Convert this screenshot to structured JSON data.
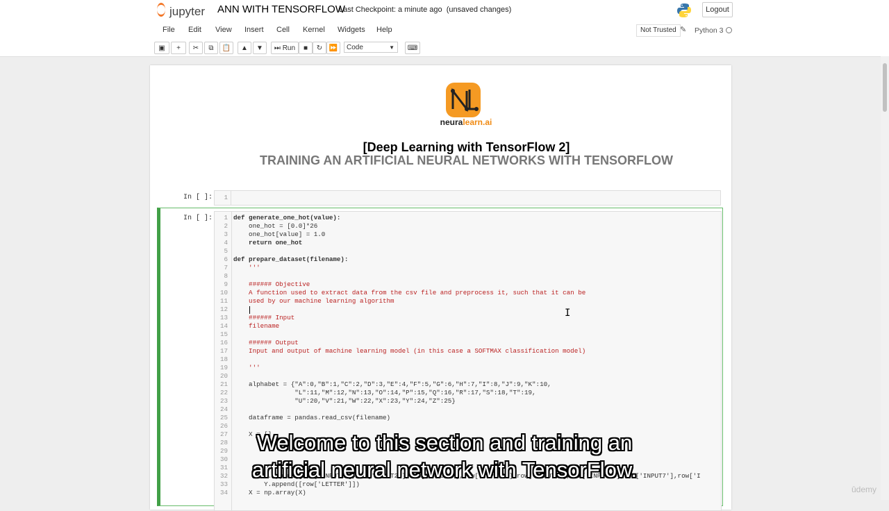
{
  "header": {
    "app_name": "jupyter",
    "notebook_title": "ANN WITH TENSORFLOW",
    "checkpoint": "Last Checkpoint: a minute ago",
    "save_status": "(unsaved changes)",
    "logout_label": "Logout"
  },
  "menubar": {
    "items": [
      "File",
      "Edit",
      "View",
      "Insert",
      "Cell",
      "Kernel",
      "Widgets",
      "Help"
    ],
    "trust_label": "Not Trusted",
    "kernel_name": "Python 3"
  },
  "toolbar": {
    "run_label": "Run",
    "cell_type": "Code"
  },
  "markdown": {
    "brand_part1": "neura",
    "brand_part2": "learn.ai",
    "heading1": "[Deep Learning with TensorFlow 2]",
    "heading2": "TRAINING AN ARTIFICIAL NEURAL NETWORKS WITH TENSORFLOW"
  },
  "cells": {
    "cell1_prompt": "In [ ]:",
    "cell1_line": "1",
    "cell2_prompt": "In [ ]:"
  },
  "code_lines": [
    [
      "1",
      "def generate_one_hot(value):"
    ],
    [
      "2",
      "    one_hot = [0.0]*26"
    ],
    [
      "3",
      "    one_hot[value] = 1.0"
    ],
    [
      "4",
      "    return one_hot"
    ],
    [
      "5",
      ""
    ],
    [
      "6",
      "def prepare_dataset(filename):"
    ],
    [
      "7",
      "    '''"
    ],
    [
      "8",
      ""
    ],
    [
      "9",
      "    ###### Objective"
    ],
    [
      "10",
      "    A function used to extract data from the csv file and preprocess it, such that it can be"
    ],
    [
      "11",
      "    used by our machine learning algorithm"
    ],
    [
      "12",
      ""
    ],
    [
      "13",
      "    ###### Input"
    ],
    [
      "14",
      "    filename"
    ],
    [
      "15",
      ""
    ],
    [
      "16",
      "    ###### Output"
    ],
    [
      "17",
      "    Input and output of machine learning model (in this case a SOFTMAX classification model)"
    ],
    [
      "18",
      ""
    ],
    [
      "19",
      "    '''"
    ],
    [
      "20",
      ""
    ],
    [
      "21",
      "    alphabet = {\"A\":0,\"B\":1,\"C\":2,\"D\":3,\"E\":4,\"F\":5,\"G\":6,\"H\":7,\"I\":8,\"J\":9,\"K\":10,"
    ],
    [
      "22",
      "                \"L\":11,\"M\":12,\"N\":13,\"O\":14,\"P\":15,\"Q\":16,\"R\":17,\"S\":18,\"T\":19,"
    ],
    [
      "23",
      "                \"U\":20,\"V\":21,\"W\":22,\"X\":23,\"Y\":24,\"Z\":25}"
    ],
    [
      "24",
      ""
    ],
    [
      "25",
      "    dataframe = pandas.read_csv(filename)"
    ],
    [
      "26",
      ""
    ],
    [
      "27",
      "    X = []"
    ],
    [
      "28",
      ""
    ],
    [
      "29",
      ""
    ],
    [
      "30",
      ""
    ],
    [
      "31",
      ""
    ],
    [
      "32",
      "        X.append([row['INPUT1'],row['INPUT2'],row['INPUT3'],row['INPUT4'],row['INPUT5'],row['INPUT6'],row['INPUT7'],row['I"
    ],
    [
      "33",
      "        Y.append([row['LETTER']])"
    ],
    [
      "34",
      "    X = np.array(X)"
    ]
  ],
  "subtitle": {
    "line1": "Welcome to this section and training an",
    "line2": "artificial neural network with TensorFlow."
  },
  "watermark": "ûdemy"
}
